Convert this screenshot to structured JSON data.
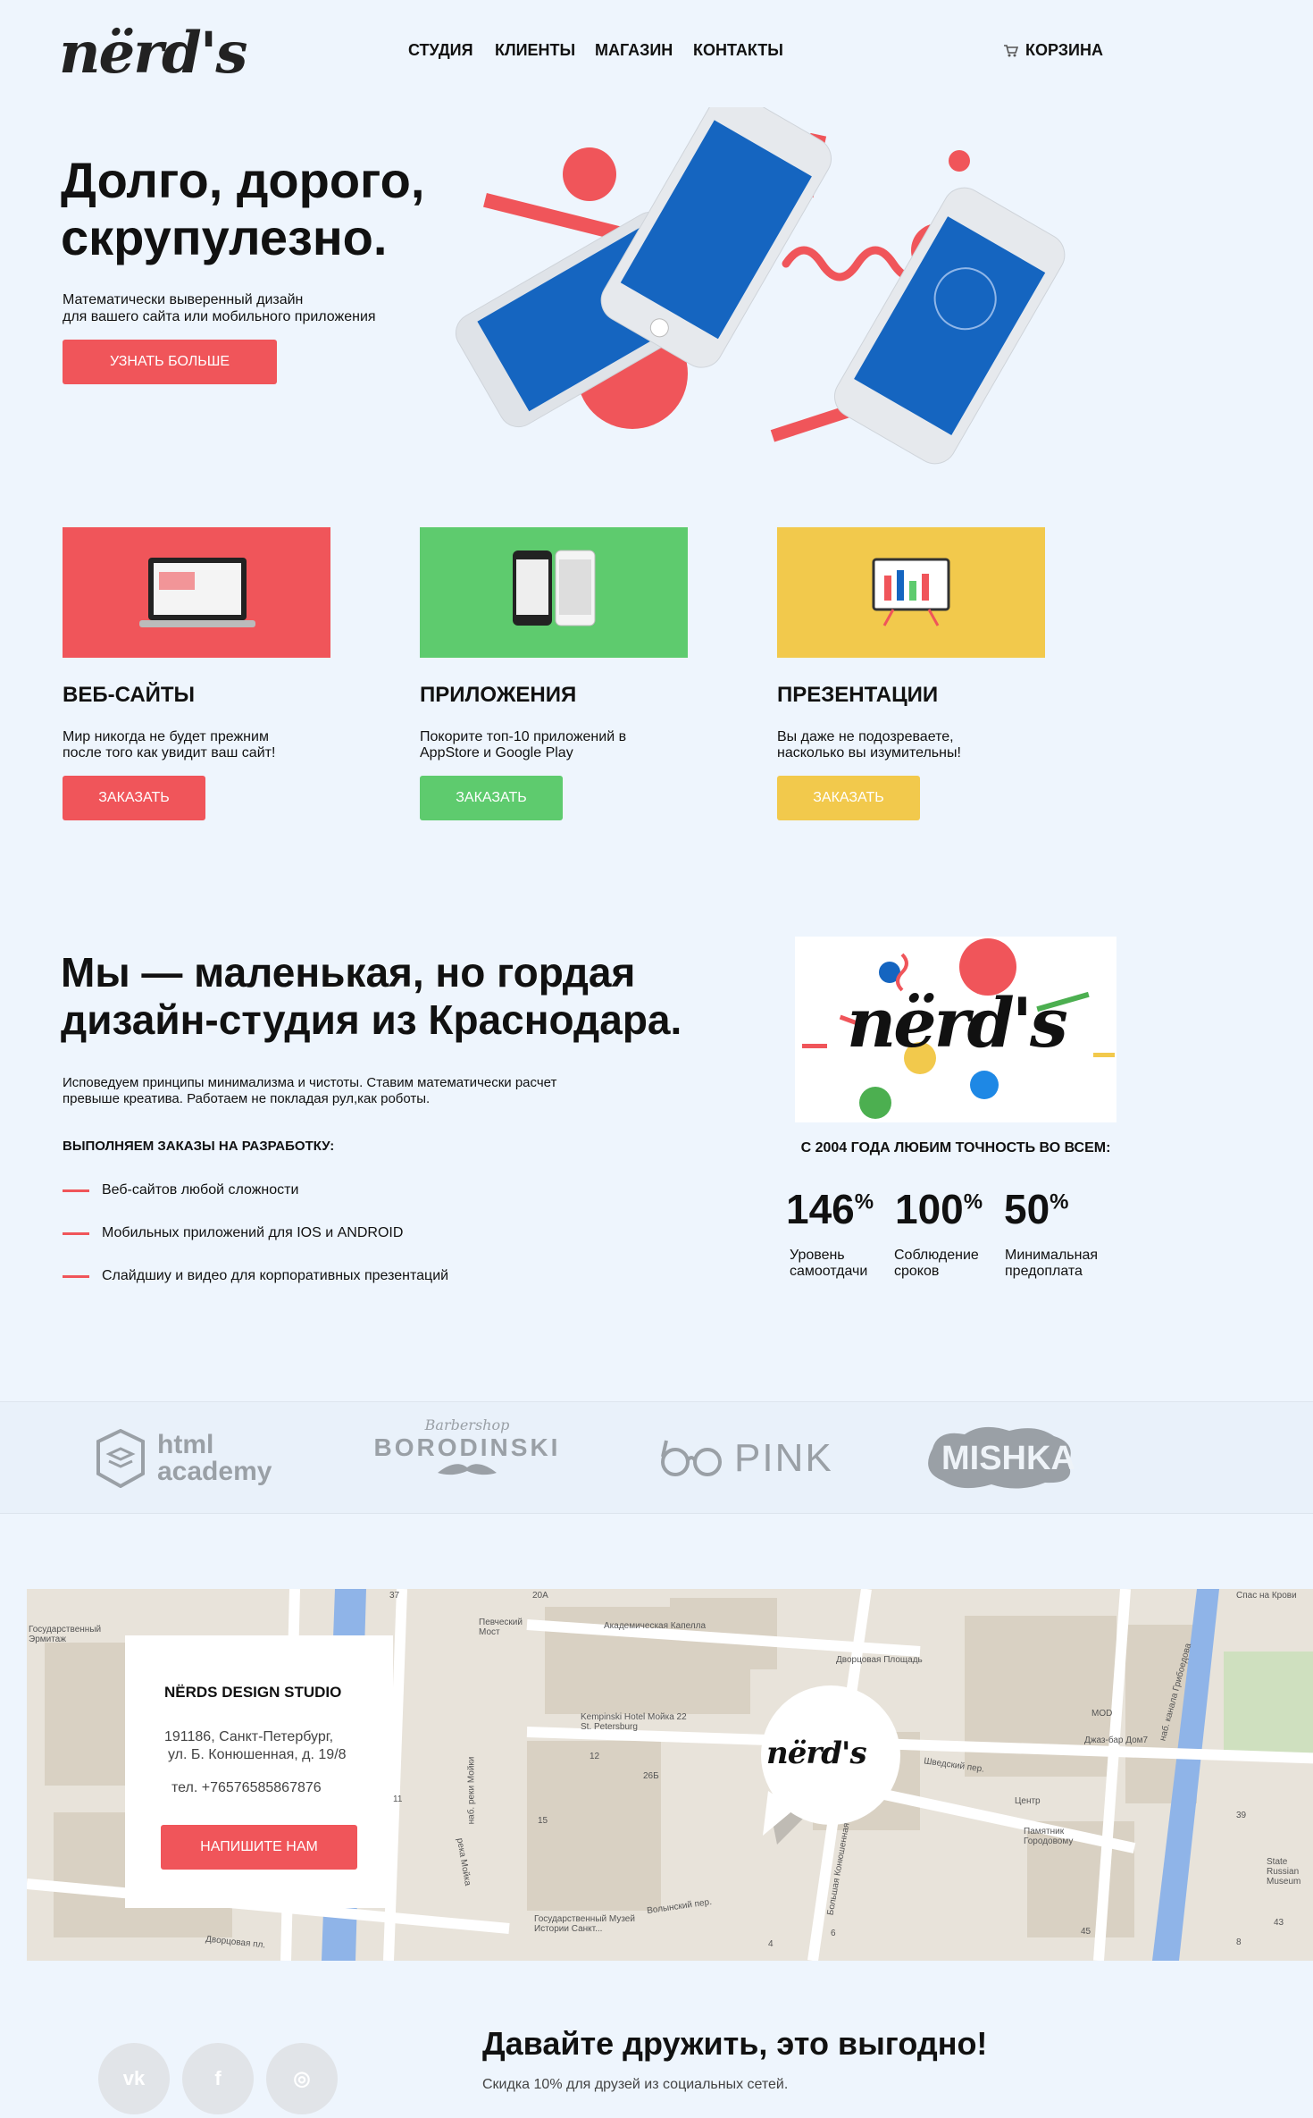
{
  "header": {
    "logo": "nërd's",
    "nav": [
      "СТУДИЯ",
      "КЛИЕНТЫ",
      "МАГАЗИН",
      "КОНТАКТЫ"
    ],
    "cart": "КОРЗИНА"
  },
  "hero": {
    "title_line1": "Долго, дорого,",
    "title_line2": "скрупулезно.",
    "subtitle_line1": "Математически выверенный дизайн",
    "subtitle_line2": "для вашего сайта или мобильного приложения",
    "button": "УЗНАТЬ БОЛЬШЕ"
  },
  "services": [
    {
      "title": "ВЕБ-САЙТЫ",
      "text_line1": "Мир никогда не будет прежним",
      "text_line2": "после того как увидит ваш сайт!",
      "button": "ЗАКАЗАТЬ",
      "color": "#f0555a",
      "icon": "laptop-icon"
    },
    {
      "title": "ПРИЛОЖЕНИЯ",
      "text_line1": "Покорите топ-10 приложений в",
      "text_line2": "AppStore и Google Play",
      "button": "ЗАКАЗАТЬ",
      "color": "#5ecb6e",
      "icon": "phones-icon"
    },
    {
      "title": "ПРЕЗЕНТАЦИИ",
      "text_line1": "Вы даже не подозреваете,",
      "text_line2": "насколько вы изумительны!",
      "button": "ЗАКАЗАТЬ",
      "color": "#f2c94c",
      "icon": "presentation-board-icon"
    }
  ],
  "about": {
    "title_line1": "Мы — маленькая, но гордая",
    "title_line2": "дизайн-студия из Краснодара.",
    "text_line1": "Исповедуем принципы минимализма и чистоты. Ставим математически расчет",
    "text_line2": "превыше креатива. Работаем не покладая рул,как роботы.",
    "subtitle": "ВЫПОЛНЯЕМ ЗАКАЗЫ НА РАЗРАБОТКУ:",
    "items": [
      "Веб-сайтов любой сложности",
      "Мобильных приложений для IOS и ANDROID",
      "Слайдшиу и видео для корпоративных презентаций"
    ],
    "logo": "nërd's",
    "since": "С 2004 ГОДА ЛЮБИМ ТОЧНОСТЬ ВО ВСЕМ:",
    "stats": [
      {
        "value": "146",
        "unit": "%",
        "label_line1": "Уровень",
        "label_line2": "самоотдачи"
      },
      {
        "value": "100",
        "unit": "%",
        "label_line1": "Соблюдение",
        "label_line2": "сроков"
      },
      {
        "value": "50",
        "unit": "%",
        "label_line1": "Минимальная",
        "label_line2": "предоплата"
      }
    ]
  },
  "partners": {
    "html_line1": "html",
    "html_line2": "academy",
    "barber_top": "Barbershop",
    "barber_name": "BORODINSKI",
    "pink": "PINK",
    "mishka": "MISHKA"
  },
  "map": {
    "labels": [
      "Государственный Эрмитаж",
      "Певческий Мост",
      "Академическая Капелла",
      "Дворцовая Площадь",
      "Kempinski Hotel Мойка 22 St. Petersburg",
      "Спас на Крови",
      "MOD",
      "Джаз-бар Дом7",
      "Шведский пер.",
      "Центр",
      "Памятник Городовому",
      "Волынский пер.",
      "Государственный Музей Истории Санкт...",
      "Большая Конюшенная ул.",
      "наб. реки Мойки",
      "река Мойка",
      "наб. канала Грибоедова",
      "State Russian Museum",
      "Дворцовая пл.",
      "20A",
      "26Б",
      "37",
      "12",
      "15",
      "39",
      "43",
      "45",
      "4",
      "6",
      "8",
      "11"
    ],
    "marker_logo": "nërd's"
  },
  "contact": {
    "title": "NËRDS DESIGN STUDIO",
    "address_line1": "191186, Санкт-Петербург,",
    "address_line2": "ул. Б. Конюшенная, д. 19/8",
    "tel": "тел. +76576585867876",
    "button": "НАПИШИТЕ НАМ"
  },
  "footer": {
    "social": [
      "vk-icon",
      "facebook-icon",
      "instagram-icon"
    ],
    "social_glyphs": [
      "vk",
      "f",
      "◎"
    ],
    "title": "Давайте дружить, это выгодно!",
    "text": "Скидка 10% для друзей из социальных сетей."
  },
  "colors": {
    "red": "#f0555a",
    "green": "#5ecb6e",
    "yellow": "#f2c94c",
    "blue": "#1565c0"
  }
}
